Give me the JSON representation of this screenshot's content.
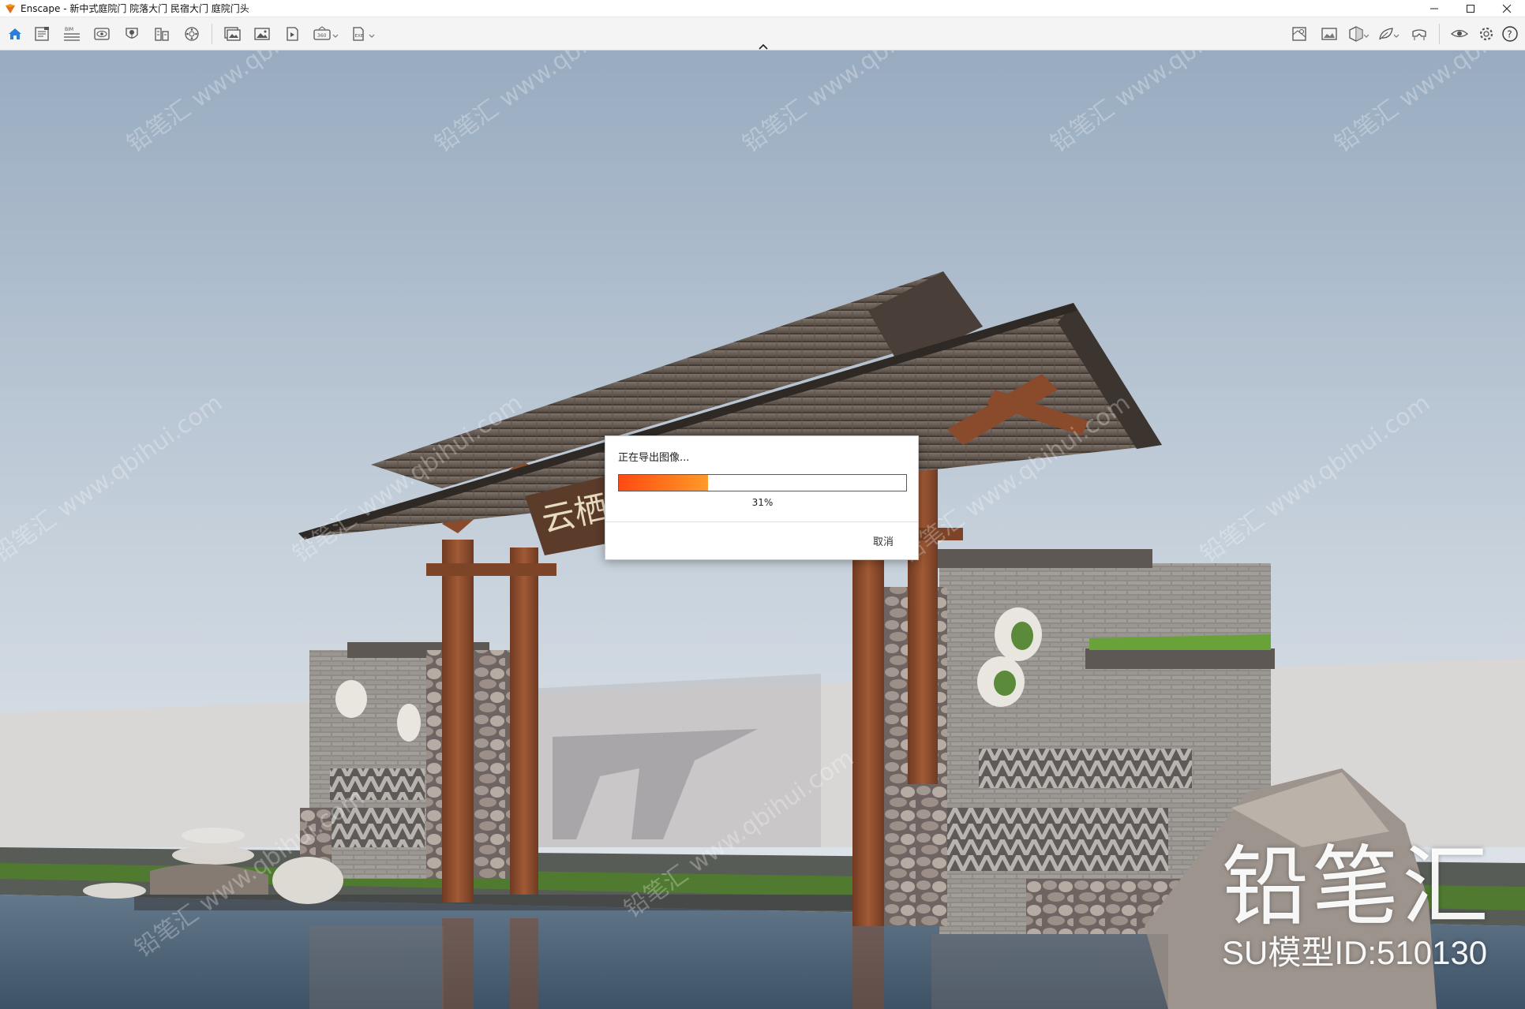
{
  "window": {
    "app_name": "Enscape",
    "title": "Enscape - 新中式庭院门 院落大门 民宿大门 庭院门头",
    "controls": [
      "minimize",
      "maximize",
      "close"
    ]
  },
  "toolbar": {
    "left_tools": [
      {
        "icon": "home-icon",
        "active": true
      },
      {
        "icon": "properties-list-icon"
      },
      {
        "icon": "bim-icon",
        "badge": "BIM"
      },
      {
        "icon": "views-eye-icon"
      },
      {
        "icon": "atmosphere-icon"
      },
      {
        "icon": "building-icon"
      },
      {
        "icon": "asset-library-icon"
      },
      {
        "icon": "batch-render-icon"
      },
      {
        "icon": "image-export-icon"
      },
      {
        "icon": "video-export-icon"
      },
      {
        "icon": "panorama-360-icon",
        "badge": "360",
        "has_dropdown": true
      },
      {
        "icon": "exe-export-icon",
        "badge": "EXE",
        "has_dropdown": true
      }
    ],
    "right_tools": [
      {
        "icon": "map-icon"
      },
      {
        "icon": "gallery-image-icon"
      },
      {
        "icon": "section-box-icon",
        "has_dropdown": true
      },
      {
        "icon": "feedback-leaf-icon",
        "has_dropdown": true
      },
      {
        "icon": "vr-headset-icon"
      },
      {
        "icon": "visibility-eye-icon"
      },
      {
        "icon": "settings-gear-icon"
      },
      {
        "icon": "help-icon"
      }
    ]
  },
  "watermark": {
    "text": "铅笔汇 www.qbihui.com",
    "brand_title": "铅笔汇",
    "brand_id": "SU模型ID:510130"
  },
  "signboard": {
    "text": "云栖"
  },
  "export_dialog": {
    "title": "正在导出图像...",
    "progress": 0.31,
    "progress_label": "31%",
    "cancel_label": "取消",
    "accent": "#ff6a1a"
  },
  "colors": {
    "accent_blue": "#2b7fd8",
    "toolbar_bg": "#f4f4f4",
    "sky_top": "#9fb1c4",
    "sky_bottom": "#e3e8ec",
    "timber": "#8a4a2c",
    "roof_tile": "#6b6058",
    "water": "#4e6378"
  }
}
